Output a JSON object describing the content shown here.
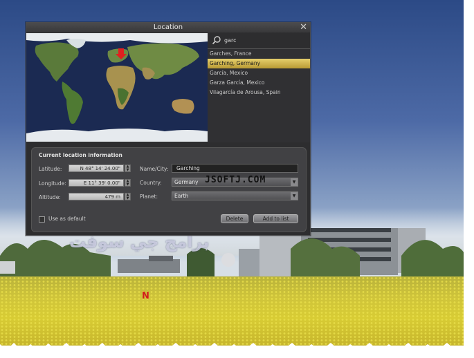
{
  "dialog": {
    "title": "Location",
    "close_icon": "close-icon"
  },
  "search": {
    "value": "garc",
    "icon": "search-icon"
  },
  "results": [
    {
      "label": "Garches, France",
      "selected": false
    },
    {
      "label": "Garching, Germany",
      "selected": true
    },
    {
      "label": "García, Mexico",
      "selected": false
    },
    {
      "label": "Garza García, Mexico",
      "selected": false
    },
    {
      "label": "Vilagarcía de Arousa, Spain",
      "selected": false
    }
  ],
  "info": {
    "title": "Current location information",
    "latitude_label": "Latitude:",
    "latitude_value": "N 48° 14' 24.00\"",
    "longitude_label": "Longitude:",
    "longitude_value": "E 11° 39' 0.00\"",
    "altitude_label": "Altitude:",
    "altitude_value": "479 m",
    "name_label": "Name/City:",
    "name_value": "Garching",
    "country_label": "Country:",
    "country_value": "Germany",
    "planet_label": "Planet:",
    "planet_value": "Earth",
    "use_default_label": "Use as default",
    "use_default_checked": false,
    "delete_label": "Delete",
    "add_label": "Add to list"
  },
  "background": {
    "compass_label": "N",
    "watermark_latin": "JSOFTJ.COM",
    "watermark_arabic": "برامج جي سوفت"
  },
  "colors": {
    "selection": "#d4b54c",
    "dialog_bg": "#2d2d2f",
    "compass": "#d21c1c"
  }
}
